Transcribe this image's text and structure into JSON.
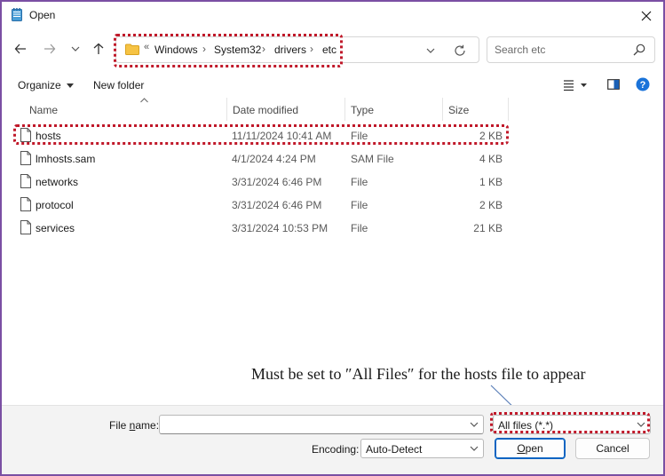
{
  "window": {
    "title": "Open",
    "close_icon": "close-icon",
    "app_icon": "notepad-icon"
  },
  "nav": {
    "back_icon": "arrow-left-icon",
    "forward_icon": "arrow-right-icon",
    "recent_icon": "chevron-down-icon",
    "up_icon": "arrow-up-icon",
    "address": {
      "overflow": "«",
      "crumbs": [
        "Windows",
        "System32",
        "drivers",
        "etc"
      ],
      "separator": "›"
    },
    "refresh_icon": "refresh-icon",
    "search": {
      "placeholder": "Search etc",
      "value": ""
    }
  },
  "toolbar": {
    "organize_label": "Organize",
    "new_folder_label": "New folder"
  },
  "list": {
    "columns": [
      "Name",
      "Date modified",
      "Type",
      "Size"
    ],
    "files": [
      {
        "name": "hosts",
        "date": "11/11/2024 10:41 AM",
        "type": "File",
        "size": "2 KB"
      },
      {
        "name": "lmhosts.sam",
        "date": "4/1/2024 4:24 PM",
        "type": "SAM File",
        "size": "4 KB"
      },
      {
        "name": "networks",
        "date": "3/31/2024 6:46 PM",
        "type": "File",
        "size": "1 KB"
      },
      {
        "name": "protocol",
        "date": "3/31/2024 6:46 PM",
        "type": "File",
        "size": "2 KB"
      },
      {
        "name": "services",
        "date": "3/31/2024 10:53 PM",
        "type": "File",
        "size": "21 KB"
      }
    ]
  },
  "annotation": {
    "text": "Must be set to ″All Files″ for the hosts file to appear"
  },
  "bottom": {
    "filename_label_pre": "File ",
    "filename_label_ul": "n",
    "filename_label_post": "ame:",
    "filename_value": "",
    "filter_value": "All files  (*.*)",
    "encoding_label": "Encoding:",
    "encoding_value": "Auto-Detect",
    "open_label_ul": "O",
    "open_label_rest": "pen",
    "cancel_label": "Cancel"
  },
  "colors": {
    "highlight": "#c0192a",
    "frame": "#7a4fa3",
    "accent": "#0a64c2"
  }
}
